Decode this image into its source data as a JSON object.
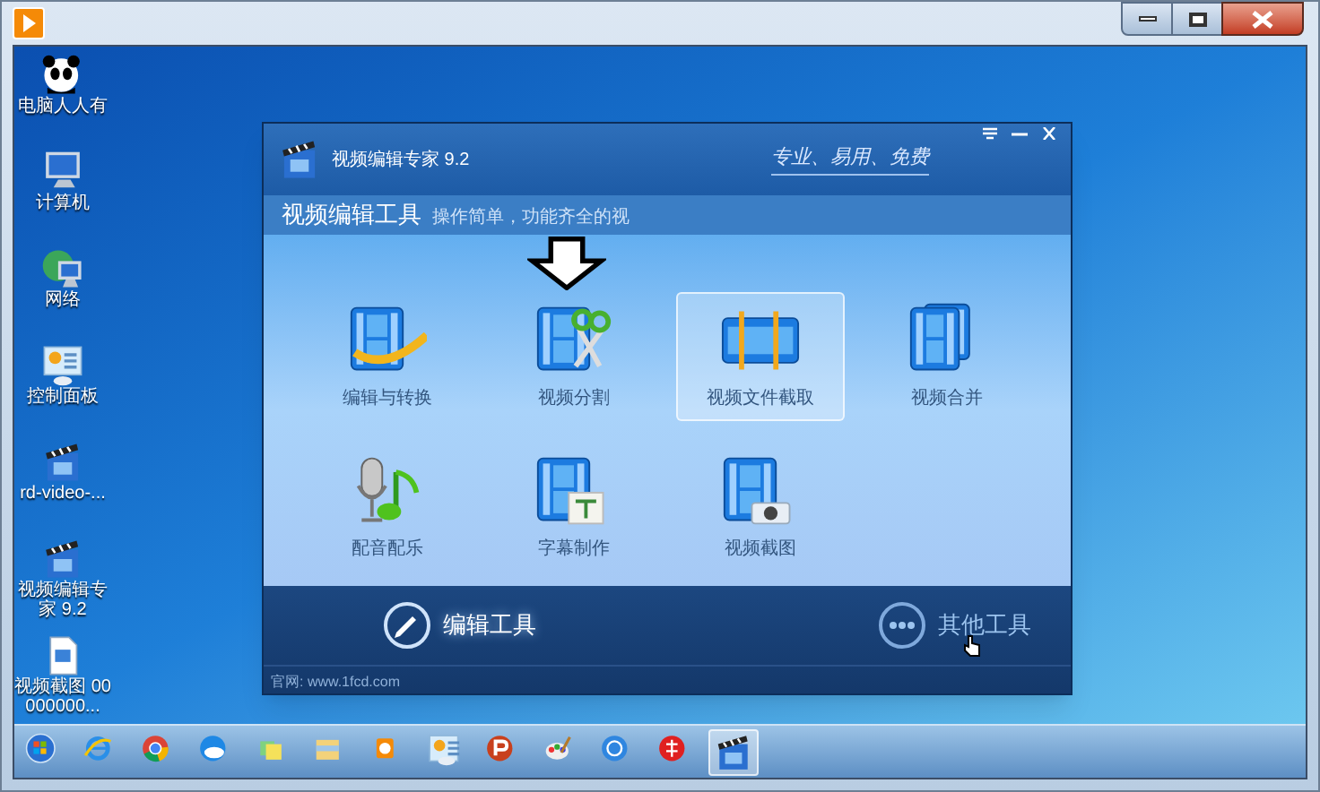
{
  "desktop_icons": [
    {
      "kind": "panda",
      "label": "电脑人人有"
    },
    {
      "kind": "computer",
      "label": "计算机"
    },
    {
      "kind": "network",
      "label": "网络"
    },
    {
      "kind": "panel",
      "label": "控制面板"
    },
    {
      "kind": "clapper",
      "label": "rd-video-..."
    },
    {
      "kind": "clapper",
      "label": "视频编辑专家 9.2"
    },
    {
      "kind": "file",
      "label": "视频截图 00000000..."
    }
  ],
  "app": {
    "title": "视频编辑专家 9.2",
    "slogan": "专业、易用、免费",
    "section_title": "视频编辑工具",
    "section_subtitle": "操作简单，功能齐全的视",
    "tools": [
      {
        "kind": "convert",
        "label": "编辑与转换",
        "selected": false
      },
      {
        "kind": "split",
        "label": "视频分割",
        "selected": false
      },
      {
        "kind": "trim",
        "label": "视频文件截取",
        "selected": true
      },
      {
        "kind": "merge",
        "label": "视频合并",
        "selected": false
      },
      {
        "kind": "audio",
        "label": "配音配乐",
        "selected": false
      },
      {
        "kind": "subtitle",
        "label": "字幕制作",
        "selected": false
      },
      {
        "kind": "snapshot",
        "label": "视频截图",
        "selected": false
      }
    ],
    "bottom_tabs": [
      {
        "kind": "pencil",
        "label": "编辑工具",
        "selected": true
      },
      {
        "kind": "dots",
        "label": "其他工具",
        "selected": false
      }
    ],
    "footer": "官网: www.1fcd.com"
  },
  "taskbar": [
    {
      "kind": "start",
      "active": false
    },
    {
      "kind": "ie",
      "active": false
    },
    {
      "kind": "chrome",
      "active": false
    },
    {
      "kind": "cloud",
      "active": false
    },
    {
      "kind": "notes",
      "active": false
    },
    {
      "kind": "folder",
      "active": false
    },
    {
      "kind": "player",
      "active": false
    },
    {
      "kind": "panel",
      "active": false
    },
    {
      "kind": "p",
      "active": false
    },
    {
      "kind": "paint",
      "active": false
    },
    {
      "kind": "dial",
      "active": false
    },
    {
      "kind": "red",
      "active": false
    },
    {
      "kind": "clapper",
      "active": true
    }
  ]
}
